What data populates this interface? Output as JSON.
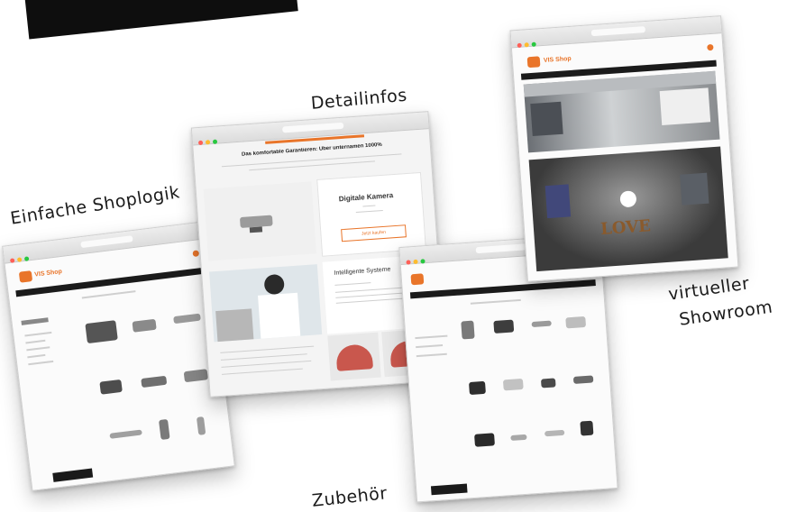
{
  "captions": {
    "detail": "Detailinfos",
    "shoplogic": "Einfache Shoplogik",
    "showroom_line1": "virtueller",
    "showroom_line2": "Showroom",
    "accessories": "Zubehör"
  },
  "brand": {
    "name": "VIS Shop",
    "accent": "#e9752a"
  },
  "detail_page": {
    "headline": "Das komfortable Garantieren: Über unternamen 1000%",
    "card_title": "Digitale Kamera",
    "card_button": "Jetzt kaufen",
    "article_title": "Intelligente Systeme"
  },
  "showroom": {
    "sign": "LOVE"
  }
}
